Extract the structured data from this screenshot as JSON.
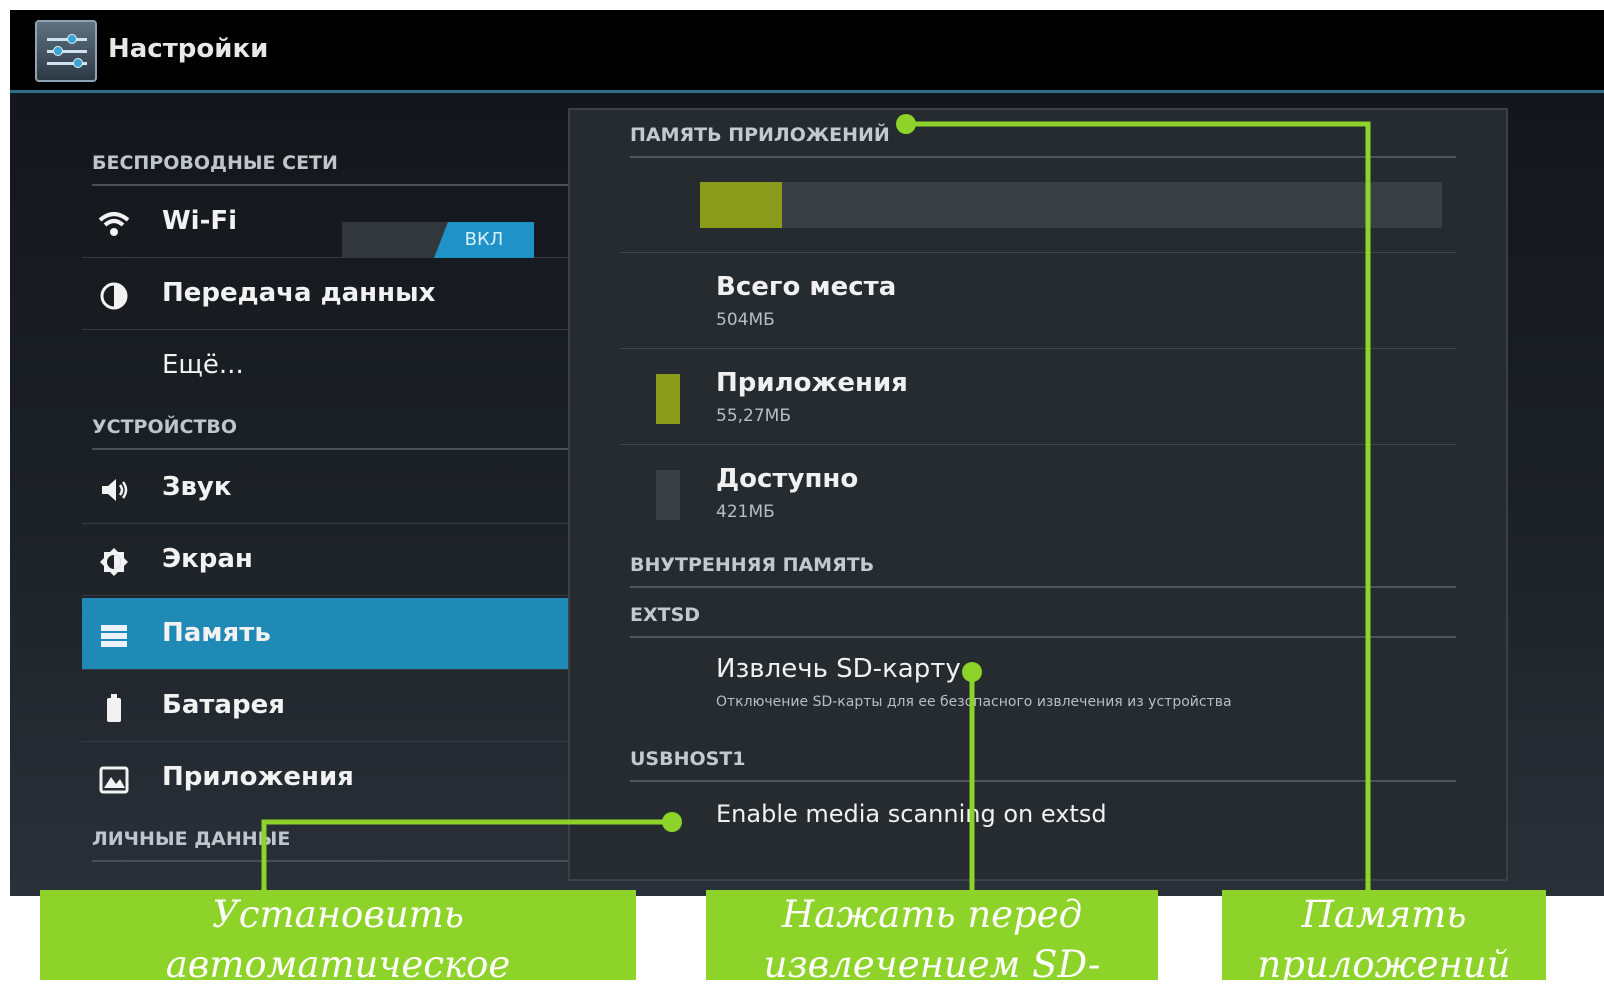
{
  "app": {
    "title": "Настройки",
    "icon": "settings-sliders-icon"
  },
  "sidebar": {
    "categories": [
      "БЕСПРОВОДНЫЕ СЕТИ",
      "УСТРОЙСТВО",
      "ЛИЧНЫЕ ДАННЫЕ"
    ],
    "items": [
      {
        "label": "Wi-Fi",
        "icon": "wifi-icon"
      },
      {
        "label": "Передача данных",
        "icon": "data-usage-icon"
      },
      {
        "label": "Ещё...",
        "icon": ""
      },
      {
        "label": "Звук",
        "icon": "speaker-icon"
      },
      {
        "label": "Экран",
        "icon": "brightness-icon"
      },
      {
        "label": "Память",
        "icon": "storage-icon",
        "selected": true
      },
      {
        "label": "Батарея",
        "icon": "battery-icon"
      },
      {
        "label": "Приложения",
        "icon": "apps-icon"
      }
    ],
    "wifi_toggle": "ВКЛ"
  },
  "storage": {
    "app_storage_header": "ПАМЯТЬ ПРИЛОЖЕНИЙ",
    "usage_fraction": 0.11,
    "total": {
      "title": "Всего места",
      "value": "504МБ"
    },
    "apps": {
      "title": "Приложения",
      "value": "55,27МБ",
      "color": "#8a9a1a"
    },
    "free": {
      "title": "Доступно",
      "value": "421МБ",
      "color": "#3a3f44"
    },
    "internal_header": "ВНУТРЕННЯЯ ПАМЯТЬ",
    "extsd_header": "EXTSD",
    "unmount": {
      "title": "Извлечь SD-карту",
      "subtitle": "Отключение SD-карты для ее безопасного извлечения из устройства"
    },
    "usbhost_header": "USBHOST1",
    "media_scan": {
      "title": "Enable media scanning on extsd"
    }
  },
  "annotations": {
    "auto_mount": "Установить автоматическое подключение SD-карты",
    "unmount_before": "Нажать перед извлечением SD-карты",
    "app_memory": "Память приложений",
    "accent": "#8ed32a"
  }
}
